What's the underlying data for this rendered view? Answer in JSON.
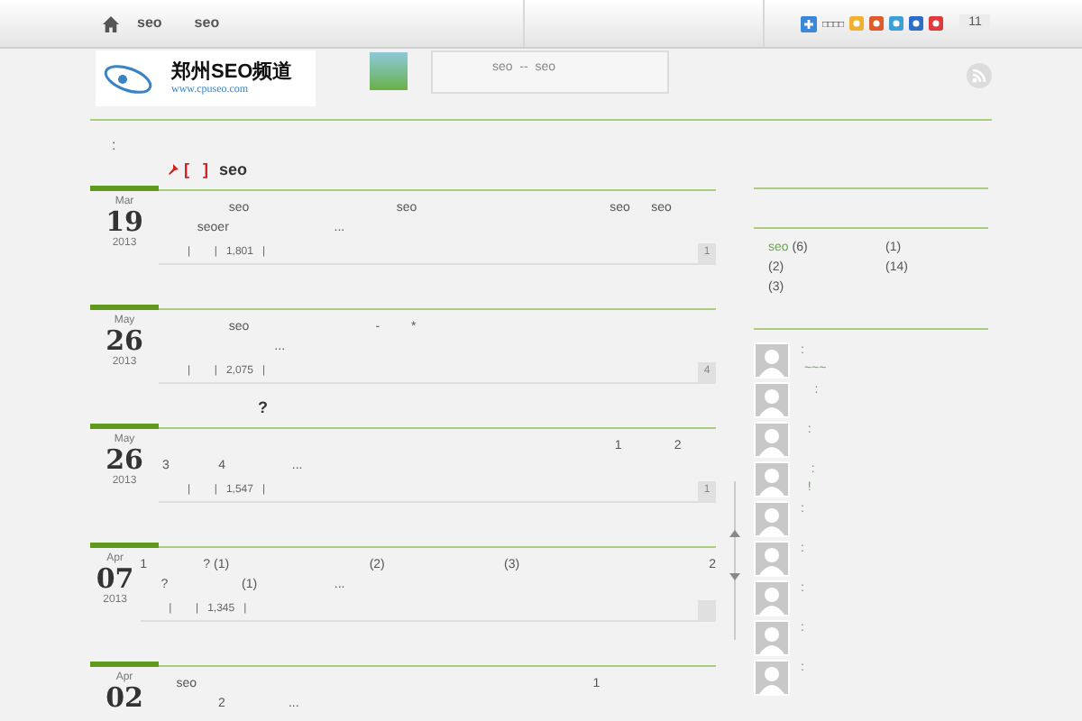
{
  "nav": {
    "items": [
      "seo",
      "seo"
    ],
    "share_label": "□□□□",
    "share_count": "11"
  },
  "header": {
    "logo_title": "郑州SEO频道",
    "logo_url": "www.cpuseo.com",
    "bubble": "seo  --  seo"
  },
  "breadcrumb": ":",
  "posts": [
    {
      "kind": "sticky",
      "month": "Mar",
      "day": "19",
      "year": "2013",
      "tag": "[   ]",
      "title": "seo",
      "line_1": "                    seo                                          seo                                                       seo      seo",
      "line_2": "           seoer                              ...",
      "meta": "|        |   1,801   |",
      "comments": "1",
      "comment_badge": true
    },
    {
      "kind": "normal",
      "month": "May",
      "day": "26",
      "year": "2013",
      "line_1": "                    seo                                    -         *",
      "line_2": "                                 ...",
      "meta": "|        |   2,075   |",
      "comments": "4",
      "comment_badge": true
    },
    {
      "kind": "normal",
      "month": "May",
      "day": "26",
      "year": "2013",
      "title": "                    ?",
      "line_1": "                                                                                                                                  1               2",
      "line_2": " 3              4                   ...",
      "meta": "|        |   1,547   |",
      "comments": "1",
      "comment_badge": true
    },
    {
      "kind": "normal",
      "month": "Apr",
      "day": "07",
      "year": "2013",
      "line_1": "1                ? (1)                                        (2)                                  (3)                                                      2",
      "line_2": "      ?                     (1)                      ...",
      "meta": "|        |   1,345   |",
      "comment_badge": true
    },
    {
      "kind": "normal",
      "month": "Apr",
      "day": "02",
      "line_1": "     seo                                                                                                                 1",
      "line_2": "                 2                  ..."
    }
  ],
  "tags": [
    {
      "name": "seo",
      "count": "(6)"
    },
    {
      "count": "(1)"
    },
    {
      "count": "(2)"
    },
    {
      "count": "(14)"
    },
    {
      "count": "(3)"
    }
  ],
  "recent_comments": [
    {
      "line": ":",
      "reply": " ~~~"
    },
    {
      "line": "    :"
    },
    {
      "line": "  :"
    },
    {
      "line": "   :",
      "reply": "  !"
    },
    {
      "line": ":"
    },
    {
      "line": ":"
    },
    {
      "line": ":"
    },
    {
      "line": ":"
    },
    {
      "line": ":"
    }
  ]
}
